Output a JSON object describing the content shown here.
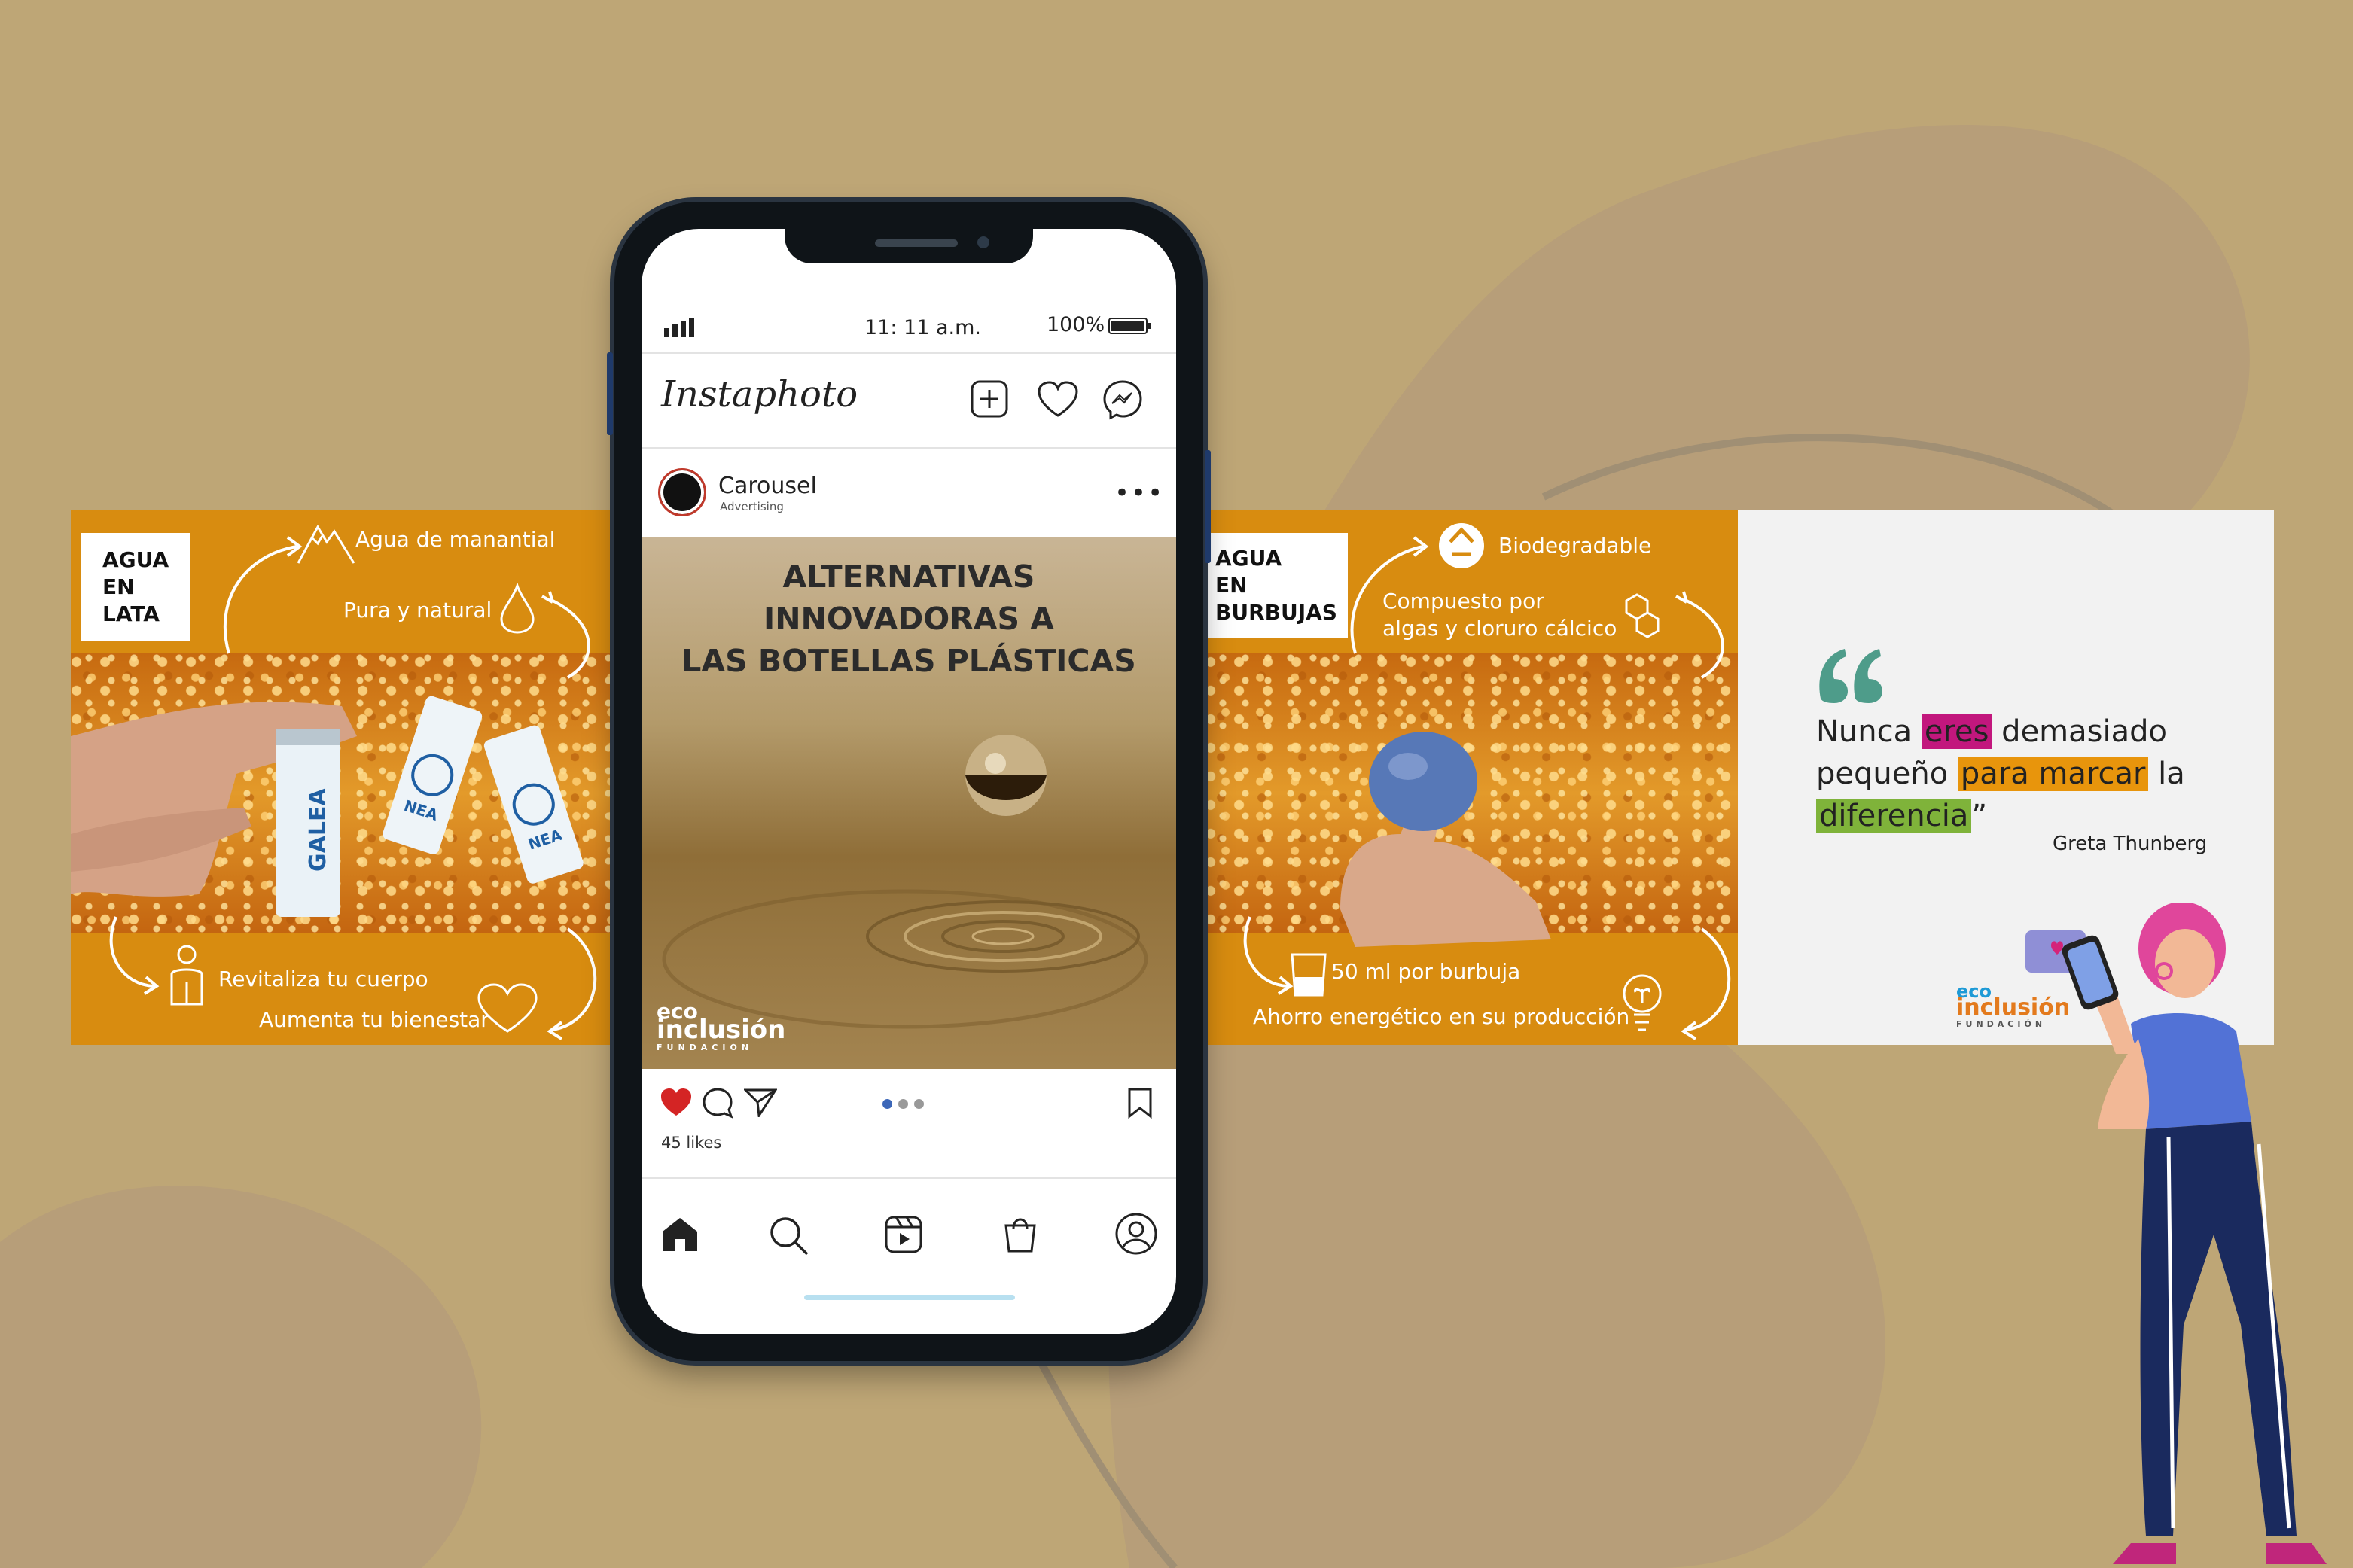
{
  "colors": {
    "background": "#bea676",
    "orange": "#d88c10",
    "quote_mark": "#4e9c8a",
    "highlight_magenta": "#c2177d",
    "highlight_orange": "#e8950c",
    "highlight_green": "#7fb33a",
    "like_red": "#d42424"
  },
  "left_panel": {
    "tag": [
      "AGUA",
      "EN",
      "LATA"
    ],
    "items": [
      "Agua de manantial",
      "Pura y natural",
      "Revitaliza tu cuerpo",
      "Aumenta tu bienestar"
    ],
    "can_labels": [
      "GALEA",
      "NEA",
      "NEA"
    ]
  },
  "phone": {
    "status": {
      "time": "11: 11 a.m.",
      "battery": "100%"
    },
    "app_name": "Instaphoto",
    "post": {
      "account": "Carousel",
      "subtitle": "Advertising",
      "headline": [
        "ALTERNATIVAS",
        "INNOVADORAS A",
        "LAS BOTELLAS PLÁSTICAS"
      ],
      "logo_top": "eco",
      "logo_main": "inclusión",
      "logo_sub": "FUNDACIÓN",
      "likes": "45 likes"
    },
    "icons": [
      "signal-icon",
      "battery-icon",
      "add-post-icon",
      "heart-icon",
      "messenger-icon",
      "more-icon",
      "like-icon",
      "comment-icon",
      "share-icon",
      "bookmark-icon",
      "home-icon",
      "search-icon",
      "reels-icon",
      "shop-icon",
      "profile-icon"
    ]
  },
  "right_panel": {
    "tag": [
      "AGUA",
      "EN",
      "BURBUJAS"
    ],
    "items": [
      "Biodegradable",
      "Compuesto por",
      "algas y cloruro cálcico",
      "50 ml por burbuja",
      "Ahorro energético en su producción"
    ]
  },
  "quote_panel": {
    "parts": [
      "Nunca ",
      "eres",
      " demasiado",
      "pequeño ",
      "para marcar",
      " la",
      "diferencia",
      "”"
    ],
    "author": "Greta Thunberg",
    "logo_top": "eco",
    "logo_main": "inclusión",
    "logo_sub": "FUNDACIÓN"
  }
}
